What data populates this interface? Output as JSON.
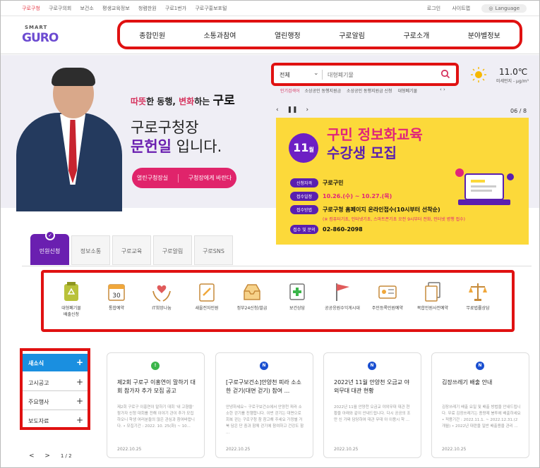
{
  "util_links": [
    "구로구청",
    "구로구의회",
    "보건소",
    "평생교육정보",
    "청렴한원",
    "구로1번가",
    "구로구홍보포털"
  ],
  "util_right": {
    "login": "로그인",
    "sitemap": "사이트맵",
    "language": "Language"
  },
  "logo": {
    "small": "SMART",
    "main": "GURO"
  },
  "nav": [
    "종합민원",
    "소통과참여",
    "열린행정",
    "구로알림",
    "구로소개",
    "분야별정보"
  ],
  "hero": {
    "slogan_pre": "따뜻",
    "slogan_mid1": "한 동행, ",
    "slogan_red": "변화",
    "slogan_mid2": "하는 ",
    "slogan_big": "구로",
    "mayor_title": "구로구청장",
    "mayor_name": "문헌일",
    "mayor_suffix": " 입니다.",
    "btn_open": "열린구청장실",
    "btn_ask": "구청장에게 바란다"
  },
  "search": {
    "scope": "전체",
    "placeholder": "대형폐기물"
  },
  "weather": {
    "temp": "11.0℃",
    "dust": "미세먼지 - μg/m³"
  },
  "keywords": {
    "label": "인기검색어",
    "items": [
      "소상공인 동행지원금",
      "소상공인 동행지원금 신청",
      "대형폐기물"
    ]
  },
  "slider": {
    "page": "06 / 8"
  },
  "banner": {
    "month_num": "11",
    "month_unit": "월",
    "title1": "구민 정보화교육",
    "title2": "수강생 모집",
    "rows": [
      {
        "tag": "신청자격",
        "text": "구로구민"
      },
      {
        "tag": "접수일정",
        "text": "10.26.(수) ~ 10.27.(목)"
      },
      {
        "tag": "접수방법",
        "text": "구로구청 홈페이지 온라인접수(10시부터 선착순)"
      },
      {
        "tag": "접수 및 문의",
        "text": "02-860-2098"
      }
    ],
    "note": "(※ 컴퓨터기초, 인터넷기초, 스마트폰기초 오전 9시부터 전화, 인터넷 병행 접수)"
  },
  "tabs": [
    "민원신청",
    "정보소통",
    "구로교육",
    "구로알림",
    "구로SNS"
  ],
  "services": [
    {
      "line1": "대형폐기물",
      "line2": "배출신청"
    },
    {
      "line1": "통합예약",
      "line2": ""
    },
    {
      "line1": "IT희망나눔",
      "line2": ""
    },
    {
      "line1": "새올전자민원",
      "line2": ""
    },
    {
      "line1": "정부24신청/발급",
      "line2": ""
    },
    {
      "line1": "보건상담",
      "line2": ""
    },
    {
      "line1": "공공응원수익게시대",
      "line2": ""
    },
    {
      "line1": "주민등록민원예약",
      "line2": ""
    },
    {
      "line1": "복합민원사전예약",
      "line2": ""
    },
    {
      "line1": "무료법률상담",
      "line2": ""
    }
  ],
  "news_tabs": [
    "새소식",
    "고시공고",
    "주요행사",
    "보도자료"
  ],
  "cards": [
    {
      "badge": "!",
      "color": "g",
      "title": "제2회 구로구 이홍연이 말하기 대회 참가자 추가 모집 공고",
      "body": "제2회 구로구 이홍연이 말하기 대회 '내 고향을' 참가자 신청 대회를 전해 이야기 관이 추가 모집하오니 학생 여러분들의 많은 관심과 참여바랍니다. • 모집기간 : 2022. 10. 25(화) ~ 10...",
      "date": "2022.10.25"
    },
    {
      "badge": "N",
      "color": "b",
      "title": "[구로구보건소]안양천 피라 소소한 걷기(대면 걷기) 참여 ...",
      "body": "안녕하세요~ 구로구보건소에서 안양천 피라 소소한 걷기를 진행합니다. 이번 걷기는 대면으로 회복 걷는 구로구청 참 참고해 주세요 가정별 거북 담은 단 중과 함께 걷기에 참여하고 건강도 함 ...",
      "date": "2022.10.25"
    },
    {
      "badge": "N",
      "color": "b",
      "title": "2022년 11월 안양천 오금교 야외무대 대관 현황",
      "body": "2022년 11월 안양천 오금교 야외무대 대관 현황을 아래와 같이 안내드립니다. 다시 공공의 조만 신 가짜 담당하여 대관 무대 아 이용시 학 ...",
      "date": "2022.10.25"
    },
    {
      "badge": "N",
      "color": "b",
      "title": "김장쓰레기 배출 안내",
      "body": "김장쓰레기 배출 요일 및 배출 방법을 안내드립니다. 무료 김장쓰레기는 종량제 봉투에 배출하세요 • 적용기간 : 2022.11.1. ~ 2022.12.31.(2개월) • 2022년 대란을 일반 배출용을 관리 ...",
      "date": "2022.10.25"
    }
  ],
  "bottom_nav": {
    "prev": "<",
    "next": ">",
    "page": "1 / 2"
  }
}
